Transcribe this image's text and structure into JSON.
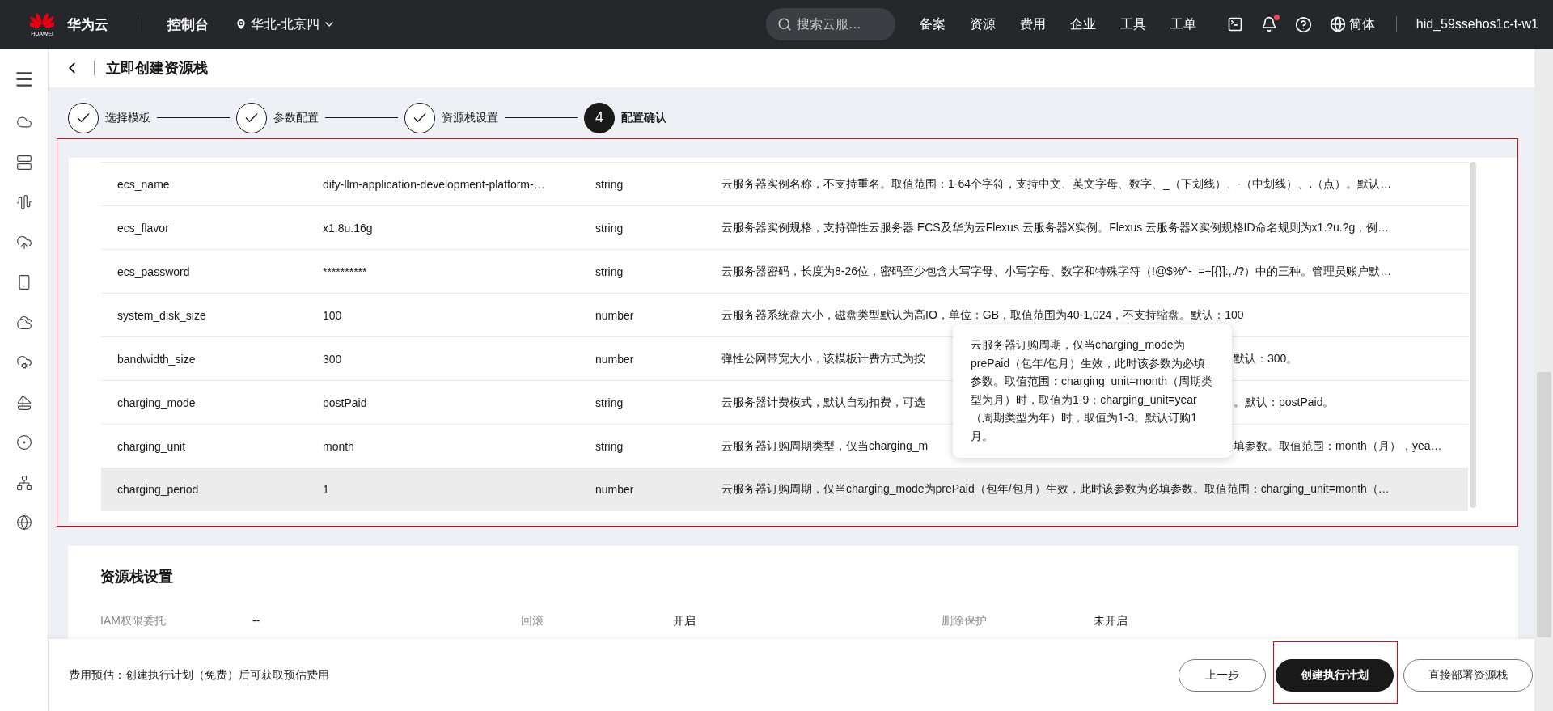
{
  "top_bar": {
    "logo_text": "HUAWEI",
    "brand": "华为云",
    "console": "控制台",
    "region": "华北-北京四",
    "search": {
      "placeholder": "搜索云服…"
    },
    "nav": [
      "备案",
      "资源",
      "费用",
      "企业",
      "工具",
      "工单"
    ],
    "notification_dot": true,
    "language": "简体",
    "user": "hid_59ssehos1c-t-w1"
  },
  "header": {
    "title": "立即创建资源栈"
  },
  "steps": [
    {
      "label": "选择模板",
      "completed": true
    },
    {
      "label": "参数配置",
      "completed": true
    },
    {
      "label": "资源栈设置",
      "completed": true
    },
    {
      "label": "配置确认",
      "completed": false,
      "number": "4"
    }
  ],
  "parameters": {
    "highlighted": true,
    "rows": [
      {
        "name": "ecs_name",
        "value": "dify-llm-application-development-platform-…",
        "type": "string",
        "description": [
          "云服务器实例名称，不支持重名。取值范围：1-64个字符，支持中文、英文字母、数字、_（下划线）、-（中划线）、.（点）。默认…"
        ],
        "hovered": false
      },
      {
        "name": "ecs_flavor",
        "value": "x1.8u.16g",
        "type": "string",
        "description": [
          "云服务器实例规格，支持弹性云服务器 ECS及华为云Flexus 云服务器X实例。Flexus 云服务器X实例规格ID命名规则为x1.?u.?g，例…"
        ],
        "hovered": false
      },
      {
        "name": "ecs_password",
        "value": "**********",
        "type": "string",
        "description": [
          "云服务器密码，长度为8-26位，密码至少包含大写字母、小写字母、数字和特殊字符（!@$%^-_=+[{}]:,./?）中的三种。管理员账户默…"
        ],
        "hovered": false
      },
      {
        "name": "system_disk_size",
        "value": "100",
        "type": "number",
        "description": [
          "云服务器系统盘大小，磁盘类型默认为高IO，单位：GB，取值范围为40-1,024，不支持缩盘。默认：100"
        ],
        "hovered": false
      },
      {
        "name": "bandwidth_size",
        "value": "300",
        "type": "number",
        "description": [
          "弹性公网带宽大小，该模板计费方式为按",
          "默认：300。"
        ],
        "hovered": false
      },
      {
        "name": "charging_mode",
        "value": "postPaid",
        "type": "string",
        "description": [
          "云服务器计费模式，默认自动扣费，可选",
          "。默认：postPaid。"
        ],
        "hovered": false
      },
      {
        "name": "charging_unit",
        "value": "month",
        "type": "string",
        "description": [
          "云服务器订购周期类型，仅当charging_m",
          "填参数。取值范围：month（月），yea…"
        ],
        "hovered": false
      },
      {
        "name": "charging_period",
        "value": "1",
        "type": "number",
        "description": [
          "云服务器订购周期，仅当charging_mode为prePaid（包年/包月）生效，此时该参数为必填参数。取值范围：charging_unit=month（…"
        ],
        "hovered": true
      }
    ]
  },
  "tooltip": {
    "text": "云服务器订购周期，仅当charging_mode为prePaid（包年/包月）生效，此时该参数为必填参数。取值范围：charging_unit=month（周期类型为月）时，取值为1-9；charging_unit=year（周期类型为年）时，取值为1-3。默认订购1月。"
  },
  "stack_settings": {
    "title": "资源栈设置",
    "fields": [
      {
        "label": "IAM权限委托",
        "value": "--"
      },
      {
        "label": "回滚",
        "value": "开启"
      },
      {
        "label": "删除保护",
        "value": "未开启"
      }
    ]
  },
  "footer": {
    "note": "费用预估：创建执行计划（免费）后可获取预估费用",
    "buttons": [
      {
        "label": "上一步",
        "kind": "secondary",
        "highlighted": false
      },
      {
        "label": "创建执行计划",
        "kind": "primary",
        "highlighted": true
      },
      {
        "label": "直接部署资源栈",
        "kind": "secondary",
        "highlighted": false
      }
    ]
  }
}
